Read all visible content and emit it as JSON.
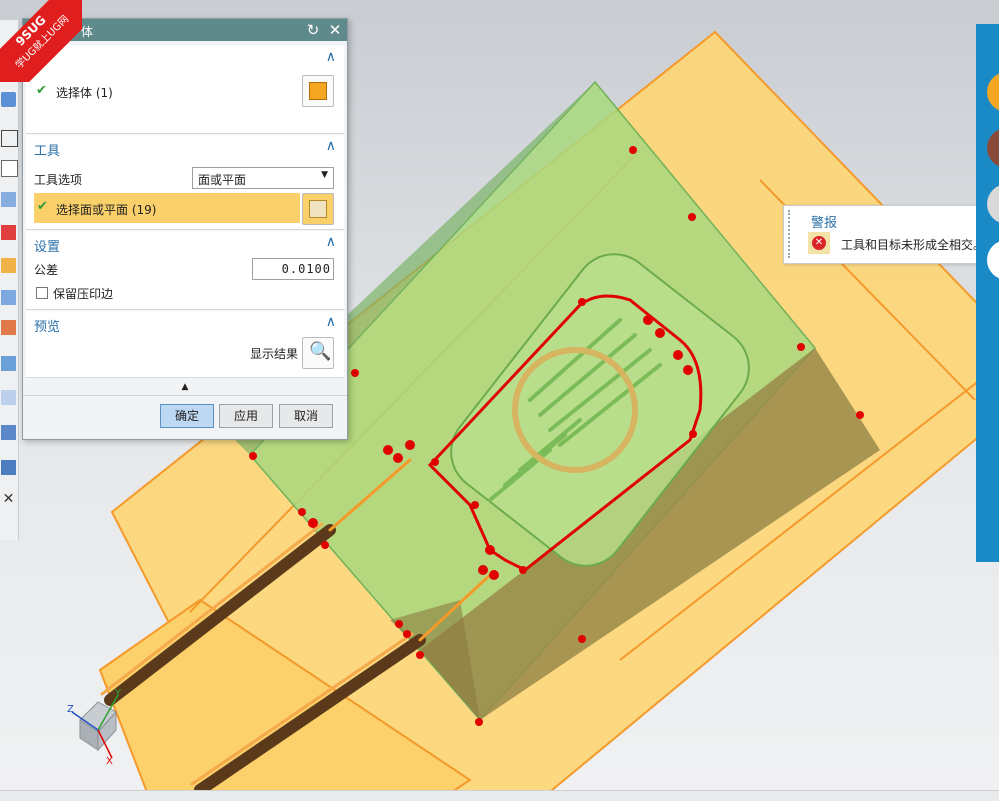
{
  "dialog": {
    "title_fragment": "体",
    "body_section": {
      "select_label": "选择体 (1)"
    },
    "tool_section": {
      "header": "工具",
      "option_label": "工具选项",
      "option_value": "面或平面",
      "select_label": "选择面或平面 (19)"
    },
    "settings_section": {
      "header": "设置",
      "tolerance_label": "公差",
      "tolerance_value": "0.0100",
      "keep_imprint_label": "保留压印边"
    },
    "preview_section": {
      "header": "预览",
      "show_result_label": "显示结果"
    },
    "buttons": {
      "ok": "确定",
      "apply": "应用",
      "cancel": "取消"
    }
  },
  "alert": {
    "title": "警报",
    "message": "工具和目标未形成全相交。"
  },
  "watermark": {
    "text1": "9SUG",
    "text2": "学UG就上UG网"
  },
  "triad": {
    "x": "X",
    "y": "Y",
    "z": "Z"
  },
  "colors": {
    "title_bar": "#5f8a8b",
    "header_blue": "#2a6fa8",
    "selected_row": "#f9d06a",
    "mold_yellow": "#fdd676",
    "core_green": "#9fd27a",
    "edge_red": "#e00000",
    "panel_blue": "#1a8ac6"
  }
}
